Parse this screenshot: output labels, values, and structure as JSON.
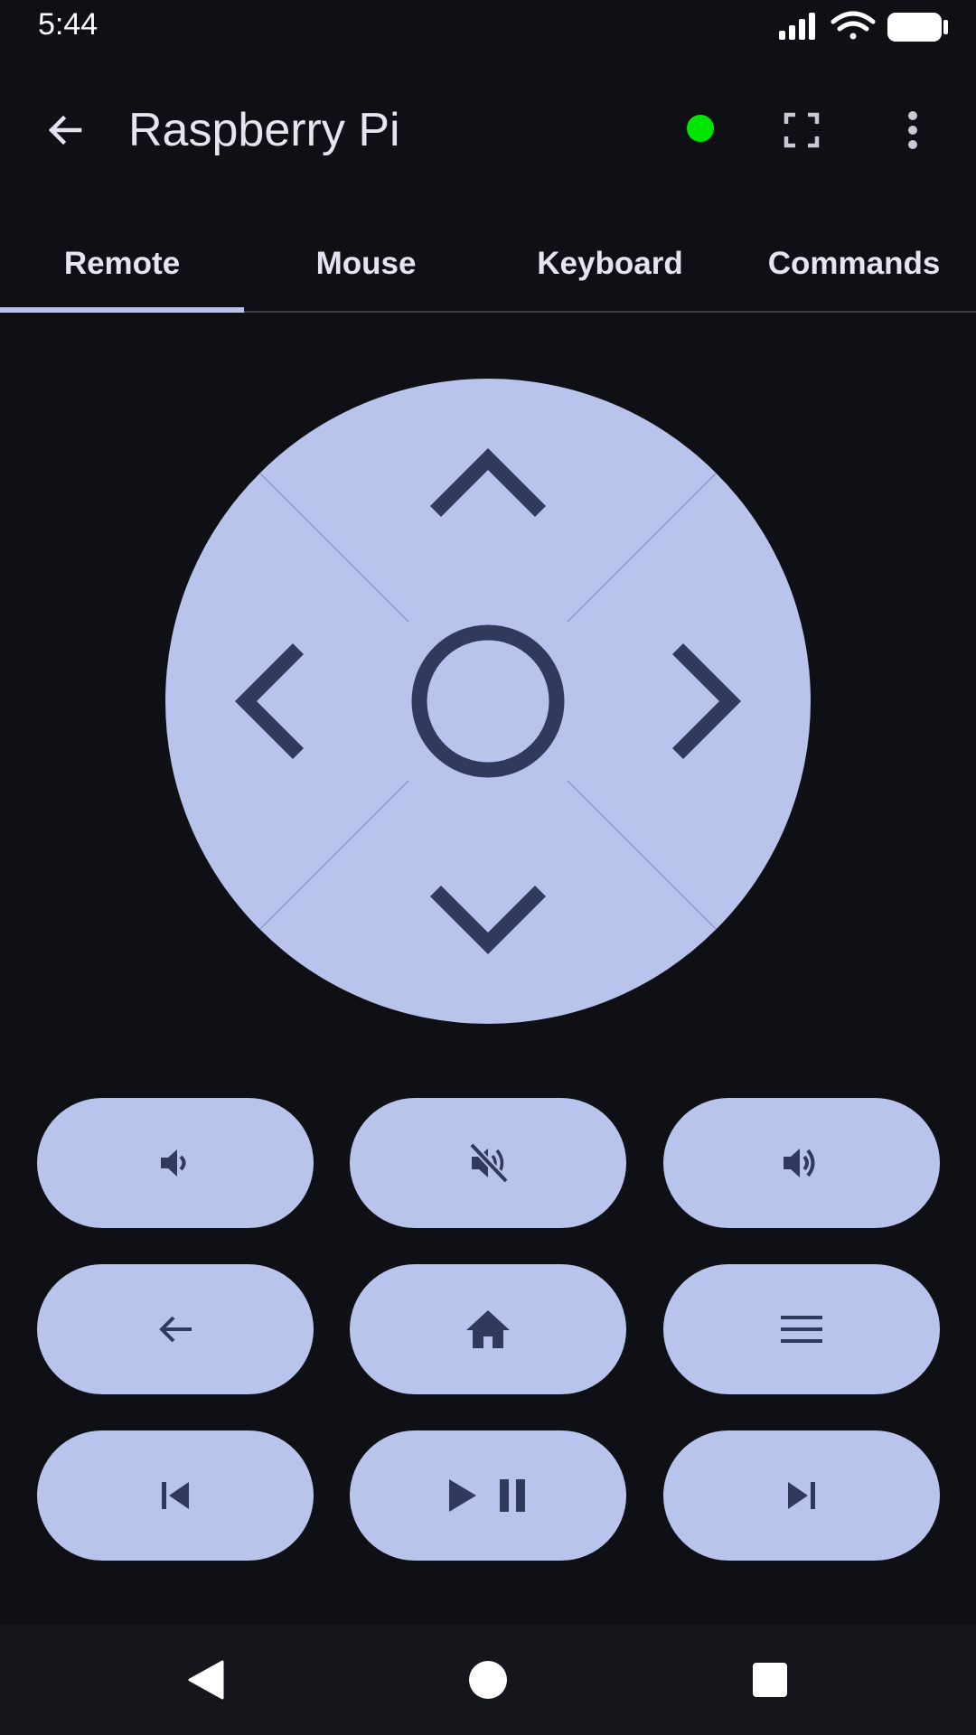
{
  "status_bar": {
    "time": "5:44"
  },
  "app_bar": {
    "title": "Raspberry Pi",
    "connection_color": "#00e600"
  },
  "tabs": [
    {
      "label": "Remote",
      "active": true
    },
    {
      "label": "Mouse",
      "active": false
    },
    {
      "label": "Keyboard",
      "active": false
    },
    {
      "label": "Commands",
      "active": false
    }
  ],
  "colors": {
    "background": "#0f1015",
    "button_fill": "#b8c4ec",
    "icon_color": "#2f3a5c",
    "tab_indicator": "#b8c4ec"
  },
  "dpad": {
    "buttons": [
      "up-icon",
      "left-icon",
      "ok-circle-icon",
      "right-icon",
      "down-icon"
    ]
  },
  "remote_buttons": [
    {
      "name": "volume-down-button",
      "icon": "volume-down-icon"
    },
    {
      "name": "mute-button",
      "icon": "volume-off-icon"
    },
    {
      "name": "volume-up-button",
      "icon": "volume-up-icon"
    },
    {
      "name": "back-button",
      "icon": "arrow-back-icon"
    },
    {
      "name": "home-button",
      "icon": "home-icon"
    },
    {
      "name": "menu-button",
      "icon": "menu-icon"
    },
    {
      "name": "previous-button",
      "icon": "skip-previous-icon"
    },
    {
      "name": "play-pause-button",
      "icon": "play-pause-icon"
    },
    {
      "name": "next-button",
      "icon": "skip-next-icon"
    }
  ],
  "nav_bar": {
    "buttons": [
      "nav-back-icon",
      "nav-home-icon",
      "nav-recents-icon"
    ]
  }
}
